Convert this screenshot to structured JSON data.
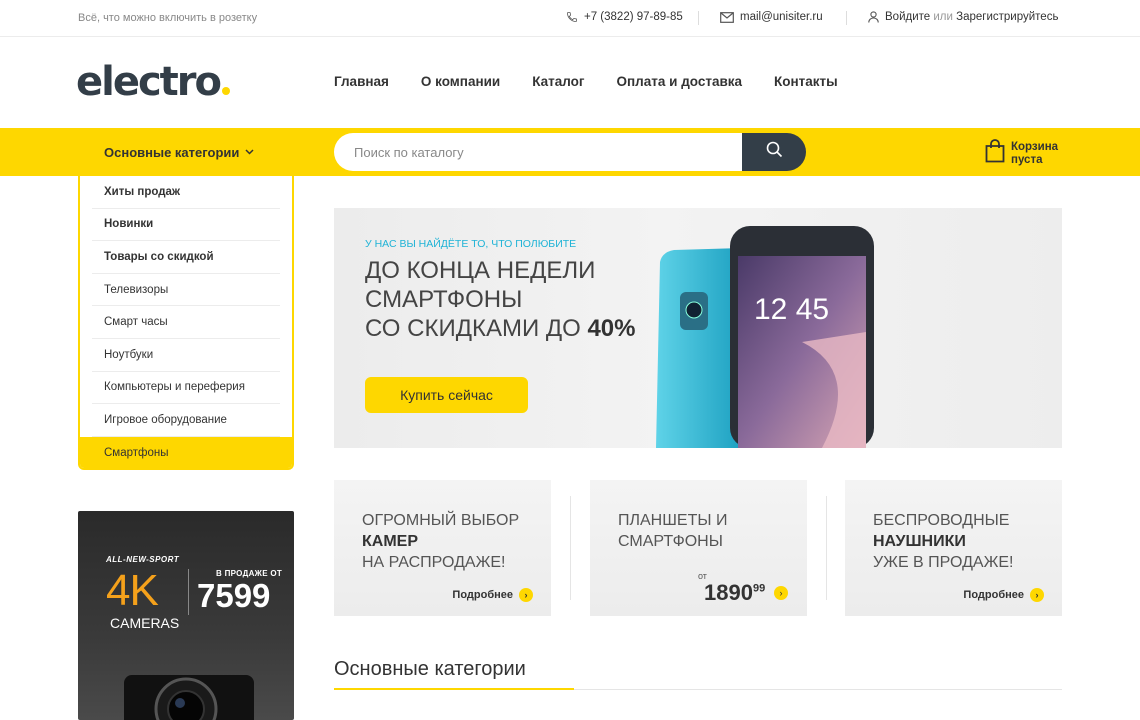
{
  "topbar": {
    "tagline": "Всё, что можно включить в розетку",
    "phone": "+7 (3822) 97-89-85",
    "email": "mail@unisiter.ru",
    "login": "Войдите",
    "or": "или",
    "register": "Зарегистрируйтесь"
  },
  "header": {
    "logo": "electro",
    "nav": [
      "Главная",
      "О компании",
      "Каталог",
      "Оплата и доставка",
      "Контакты"
    ]
  },
  "bar": {
    "categories_label": "Основные категории",
    "search_placeholder": "Поиск по каталогу",
    "cart_line1": "Корзина",
    "cart_line2": "пуста"
  },
  "sidebar": {
    "items": [
      "Хиты продаж",
      "Новинки",
      "Товары со скидкой",
      "Телевизоры",
      "Смарт часы",
      "Ноутбуки",
      "Компьютеры и переферия",
      "Игровое оборудование",
      "Смартфоны"
    ]
  },
  "banner": {
    "kicker": "У НАС ВЫ НАЙДЁТЕ ТО, ЧТО ПОЛЮБИТЕ",
    "line1": "ДО КОНЦА НЕДЕЛИ",
    "line2": "СМАРТФОНЫ",
    "line3": "СО СКИДКАМИ ДО",
    "discount": "40%",
    "button": "Купить сейчас",
    "phone_time": "12 45"
  },
  "tiles": [
    {
      "l1": "ОГРОМНЫЙ ВЫБОР",
      "l2": "КАМЕР",
      "l3": "НА РАСПРОДАЖЕ!",
      "more": "Подробнее"
    },
    {
      "l1": "ПЛАНШЕТЫ И",
      "l2": "СМАРТФОНЫ",
      "from": "от",
      "price": "1890",
      "cents": "99"
    },
    {
      "l1": "БЕСПРОВОДНЫЕ",
      "l2": "НАУШНИКИ",
      "l3": "УЖЕ В ПРОДАЖЕ!",
      "more": "Подробнее"
    }
  ],
  "side_promo": {
    "kicker": "ALL-NEW-SPORT",
    "big": "4K",
    "cams": "CAMERAS",
    "sale": "В ПРОДАЖЕ ОТ",
    "price": "7599"
  },
  "section": {
    "title": "Основные категории"
  },
  "colors": {
    "accent": "#fed700",
    "dark": "#333e48",
    "kicker": "#1fb3d6"
  }
}
